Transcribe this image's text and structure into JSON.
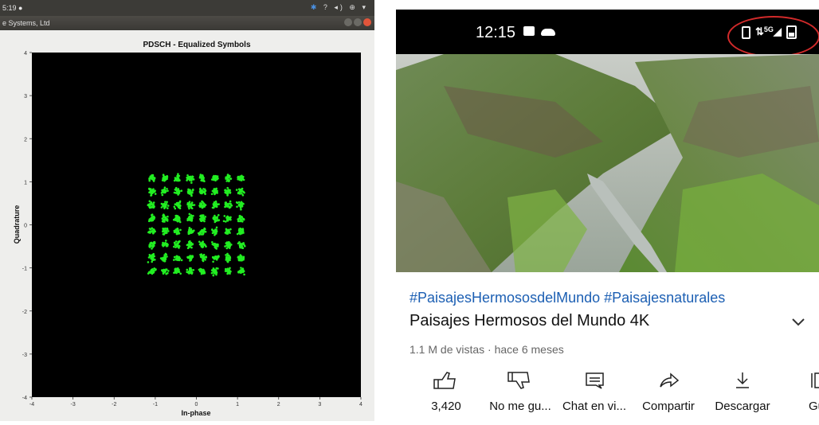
{
  "desktop": {
    "topbar": {
      "time": "5:19 ●",
      "tray": "? ◂) ⊕ ▾"
    },
    "window_title": "e Systems, Ltd"
  },
  "chart_data": {
    "type": "scatter",
    "title": "PDSCH - Equalized Symbols",
    "xlabel": "In-phase",
    "ylabel": "Quadrature",
    "xlim": [
      -4,
      4
    ],
    "ylim": [
      -4,
      4
    ],
    "x_ticks": [
      "-4",
      "-3",
      "-2",
      "-1",
      "0",
      "1",
      "2",
      "3",
      "4"
    ],
    "y_ticks": [
      "4",
      "3",
      "2",
      "1",
      "0",
      "-1",
      "-2",
      "-3",
      "-4"
    ],
    "background": "#000000",
    "point_color": "#22ee22",
    "constellation": "64-QAM",
    "levels": [
      -1.08,
      -0.77,
      -0.46,
      -0.15,
      0.15,
      0.46,
      0.77,
      1.08
    ],
    "points_per_cluster": 26
  },
  "phone": {
    "status": {
      "time": "12:15",
      "network": "5G"
    },
    "hashtags": "#PaisajesHermososdelMundo #Paisajesnaturales",
    "title": "Paisajes Hermosos del Mundo 4K",
    "meta": "1.1 M de vistas · hace 6 meses",
    "actions": [
      {
        "icon": "like-icon",
        "label": "3,420"
      },
      {
        "icon": "dislike-icon",
        "label": "No me gu..."
      },
      {
        "icon": "chat-icon",
        "label": "Chat en vi..."
      },
      {
        "icon": "share-icon",
        "label": "Compartir"
      },
      {
        "icon": "download-icon",
        "label": "Descargar"
      },
      {
        "icon": "save-icon",
        "label": "Gu"
      }
    ]
  }
}
